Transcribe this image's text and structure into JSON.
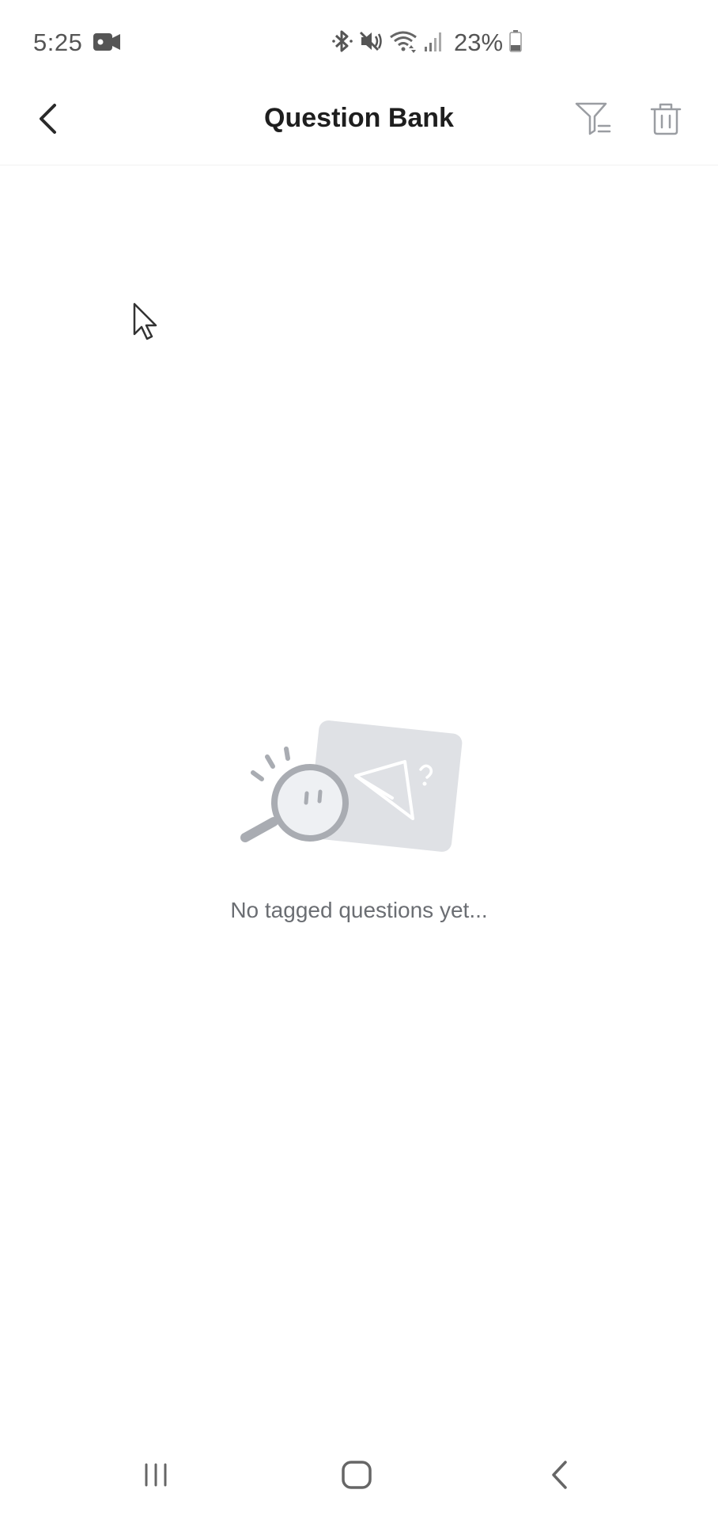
{
  "status_bar": {
    "time": "5:25",
    "battery_percent": "23%",
    "icons": [
      "video-record-icon",
      "bluetooth-icon",
      "mute-icon",
      "wifi-icon",
      "signal-icon",
      "battery-icon"
    ]
  },
  "app_bar": {
    "title": "Question Bank",
    "back_icon": "chevron-left-icon",
    "filter_icon": "filter-icon",
    "delete_icon": "trash-icon"
  },
  "empty_state": {
    "message": "No tagged questions yet...",
    "illustration_icon": "magnifier-card-illustration"
  },
  "nav_bar": {
    "icons": [
      "recents-icon",
      "home-icon",
      "back-icon"
    ]
  },
  "colors": {
    "title": "#1e1e1e",
    "icon": "#9a9da2",
    "message": "#6b6e73",
    "illustration": "#dcdee2"
  }
}
